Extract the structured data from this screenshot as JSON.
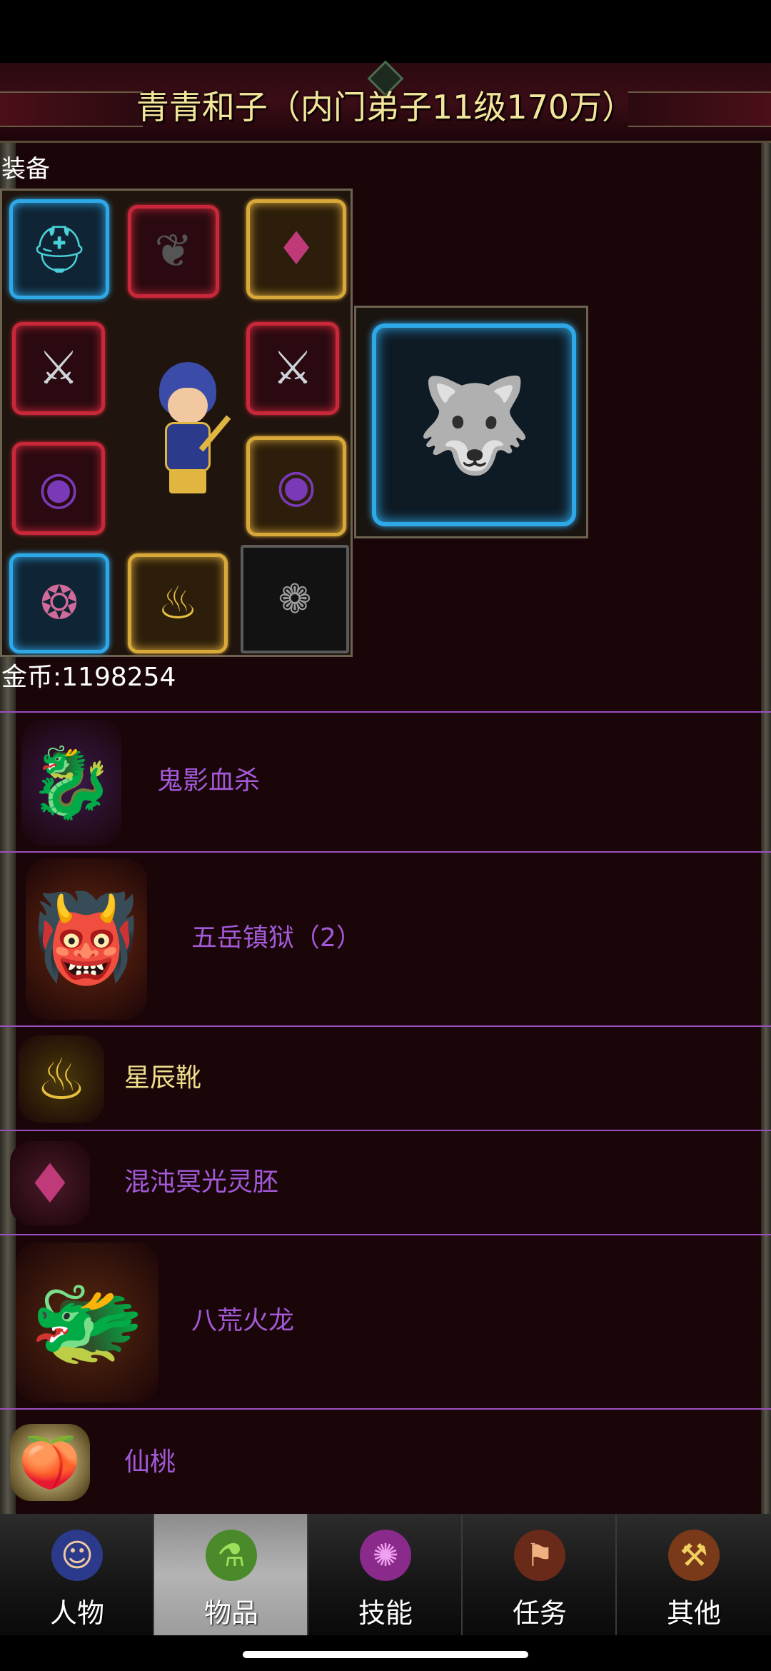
{
  "header": {
    "title": "青青和子（内门弟子11级170万）"
  },
  "equipment": {
    "section_label": "装备",
    "slots": [
      {
        "icon": "helmet-icon",
        "rarity": "blue"
      },
      {
        "icon": "wings-icon",
        "rarity": "red"
      },
      {
        "icon": "amulet-icon",
        "rarity": "gold"
      },
      {
        "icon": "sword-icon",
        "rarity": "red"
      },
      {
        "icon": "sword-icon",
        "rarity": "red"
      },
      {
        "icon": "bracer-icon",
        "rarity": "red"
      },
      {
        "icon": "bracer-icon",
        "rarity": "gold"
      },
      {
        "icon": "armor-icon",
        "rarity": "blue"
      },
      {
        "icon": "boots-icon",
        "rarity": "gold"
      },
      {
        "icon": "bead-necklace-icon",
        "rarity": "empty"
      }
    ],
    "character_icon": "hero-avatar-icon",
    "pet_icon": "beast-mount-icon"
  },
  "gold": {
    "text": "金币:1198254"
  },
  "items": [
    {
      "name": "鬼影血杀",
      "icon": "shadow-dragon-icon",
      "color": "#a35ad8"
    },
    {
      "name": "五岳镇狱（2）",
      "icon": "fire-imp-icon",
      "color": "#a35ad8"
    },
    {
      "name": "星辰靴",
      "icon": "boots-icon",
      "color": "#f0de8c"
    },
    {
      "name": "混沌冥光灵胚",
      "icon": "amulet-icon",
      "color": "#a35ad8"
    },
    {
      "name": "八荒火龙",
      "icon": "fire-dragon-icon",
      "color": "#a35ad8"
    },
    {
      "name": "仙桃",
      "icon": "peach-icon",
      "color": "#a35ad8"
    }
  ],
  "tabs": [
    {
      "label": "人物",
      "icon": "character-icon",
      "active": false
    },
    {
      "label": "物品",
      "icon": "potion-icon",
      "active": true
    },
    {
      "label": "技能",
      "icon": "skill-orb-icon",
      "active": false
    },
    {
      "label": "任务",
      "icon": "quest-icon",
      "active": false
    },
    {
      "label": "其他",
      "icon": "other-icon",
      "active": false
    }
  ]
}
